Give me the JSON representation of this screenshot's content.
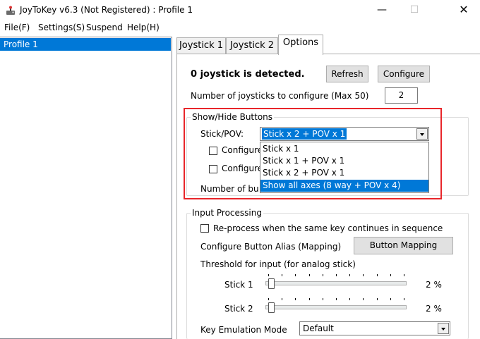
{
  "window": {
    "title": "JoyToKey v6.3 (Not Registered) : Profile 1",
    "min_glyph": "—",
    "max_glyph": "☐",
    "close_glyph": "✕",
    "icon": "joystick-app-icon"
  },
  "menu": [
    "File(F)",
    "Settings(S)",
    "Suspend",
    "Help(H)"
  ],
  "profiles": {
    "selected": "Profile 1"
  },
  "tabs": [
    "Joystick 1",
    "Joystick 2",
    "Options"
  ],
  "options": {
    "detected_label": "0 joystick is detected.",
    "refresh_label": "Refresh",
    "configure_label": "Configure",
    "num_joysticks_label": "Number of joysticks to configure (Max 50)",
    "num_joysticks_value": "2",
    "show_hide": {
      "title": "Show/Hide Buttons",
      "stick_pov_label": "Stick/POV:",
      "stick_pov_value": "Stick x 2 + POV x 1",
      "configure_1": "Configure",
      "configure_2": "Configure",
      "number_partial": "Number of bu",
      "dropdown_options": [
        "Stick x 1",
        "Stick x 1 + POV x 1",
        "Stick x 2 + POV x 1",
        "Show all axes (8 way + POV x 4)"
      ]
    },
    "input_processing": {
      "title": "Input Processing",
      "reprocess_label": "Re-process when the same key continues in sequence",
      "alias_label": "Configure Button Alias (Mapping)",
      "mapping_button": "Button Mapping",
      "threshold_label": "Threshold for input (for analog stick)",
      "stick1_label": "Stick 1",
      "stick1_value": "2 %",
      "stick1_fraction": 0.02,
      "stick2_label": "Stick 2",
      "stick2_value": "2 %",
      "stick2_fraction": 0.02,
      "key_emulation_label": "Key Emulation Mode",
      "key_emulation_value": "Default"
    }
  },
  "colors": {
    "selection": "#0078d7",
    "annotation_box": "#e8262a"
  }
}
